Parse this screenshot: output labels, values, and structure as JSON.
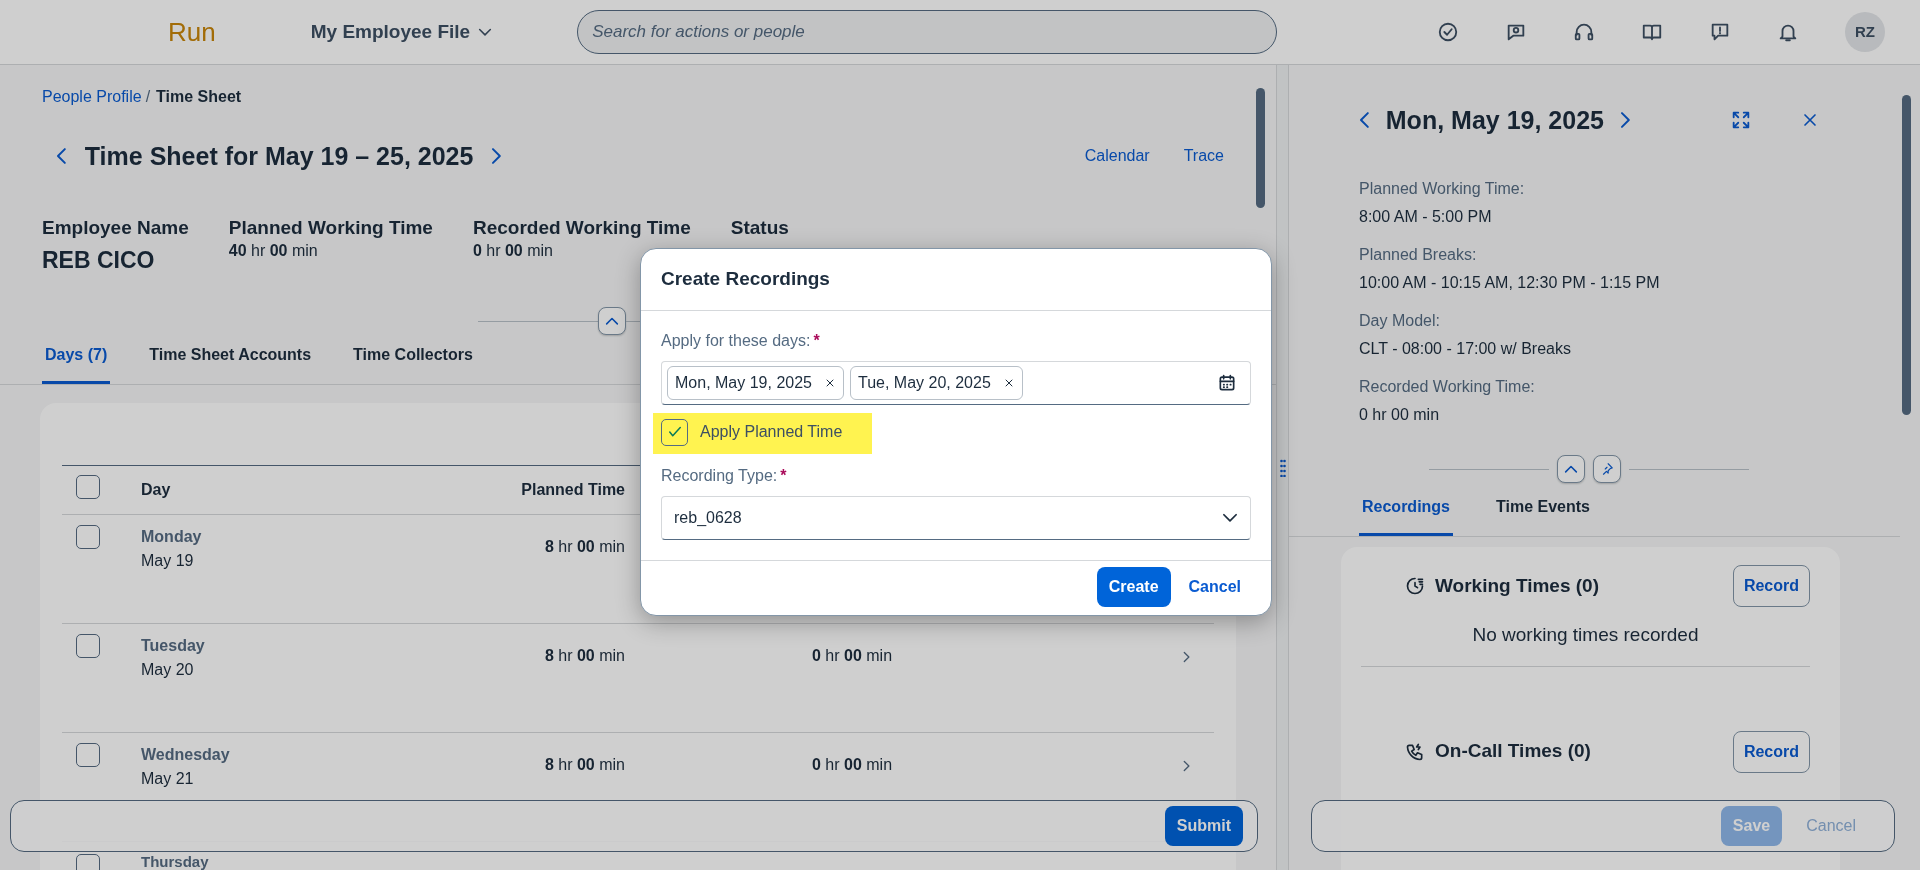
{
  "header": {
    "logo": "Run",
    "app_menu": "My Employee File",
    "search": {
      "placeholder": "Search for actions or people"
    },
    "avatar": "RZ"
  },
  "breadcrumb": [
    {
      "label": "People Profile",
      "link": true,
      "separator": "/"
    },
    {
      "label": "Time Sheet",
      "link": false
    }
  ],
  "page_title": "Time Sheet for May 19 – 25, 2025",
  "actions": [
    "Calendar",
    "Trace"
  ],
  "summary": [
    {
      "kind": "name",
      "label": "Employee Name",
      "value": "REB CICO"
    },
    {
      "kind": "duration",
      "label": "Planned Working Time",
      "value": "**40** hr  **00** min"
    },
    {
      "kind": "duration",
      "label": "Recorded Working Time",
      "value": "**0** hr  **00** min"
    },
    {
      "kind": "status",
      "label": "Status"
    }
  ],
  "tabs": [
    {
      "label": "Days (7)",
      "selected": true
    },
    {
      "label": "Time Sheet Accounts",
      "selected": false
    },
    {
      "label": "Time Collectors",
      "selected": false
    }
  ],
  "table": {
    "columns": [
      "Day",
      "Planned Time"
    ],
    "select_all_checked": false,
    "rows": [
      {
        "day": "Monday",
        "date": "May 19",
        "planned": "**8** hr  **00** min",
        "checked": false
      },
      {
        "day": "Tuesday",
        "date": "May 20",
        "planned": "**8** hr  **00** min",
        "recorded": "**0** hr  **00** min",
        "checked": false
      },
      {
        "day": "Wednesday",
        "date": "May 21",
        "planned": "**8** hr  **00** min",
        "recorded": "**0** hr  **00** min",
        "checked": false
      },
      {
        "day": "Thursday",
        "checked": false
      }
    ]
  },
  "footer": {
    "button": "Submit"
  },
  "detail": {
    "title": "Mon, May 19, 2025",
    "fields": [
      {
        "label": "Planned Working Time:",
        "value": "8:00 AM - 5:00 PM"
      },
      {
        "label": "Planned Breaks:",
        "value": "10:00 AM - 10:15 AM, 12:30 PM - 1:15 PM"
      },
      {
        "label": "Day Model:",
        "value": "CLT - 08:00 - 17:00 w/ Breaks"
      },
      {
        "label": "Recorded Working Time:",
        "value": "0 hr 00 min"
      }
    ],
    "tabs": [
      {
        "label": "Recordings",
        "selected": true
      },
      {
        "label": "Time Events",
        "selected": false
      }
    ],
    "sections": [
      {
        "kind": "working",
        "title": "Working Times (0)",
        "button": "Record",
        "empty": "No working times recorded"
      },
      {
        "kind": "oncall",
        "title": "On-Call Times (0)",
        "button": "Record"
      }
    ],
    "footer": [
      {
        "kind": "primary",
        "label": "Save",
        "disabled": true
      },
      {
        "kind": "link",
        "label": "Cancel",
        "disabled": true
      }
    ]
  },
  "dialog": {
    "title": "Create Recordings",
    "days_field": {
      "label": "Apply for these days:",
      "required_mark": "*",
      "tokens": [
        "Mon, May 19, 2025",
        "Tue, May 20, 2025"
      ]
    },
    "checkbox": {
      "label": "Apply Planned Time",
      "checked": true,
      "highlighted": true
    },
    "type_field": {
      "label": "Recording Type:",
      "required_mark": "*",
      "value": "reb_0628"
    },
    "buttons": [
      {
        "kind": "primary",
        "label": "Create"
      },
      {
        "kind": "link",
        "label": "Cancel"
      }
    ]
  }
}
